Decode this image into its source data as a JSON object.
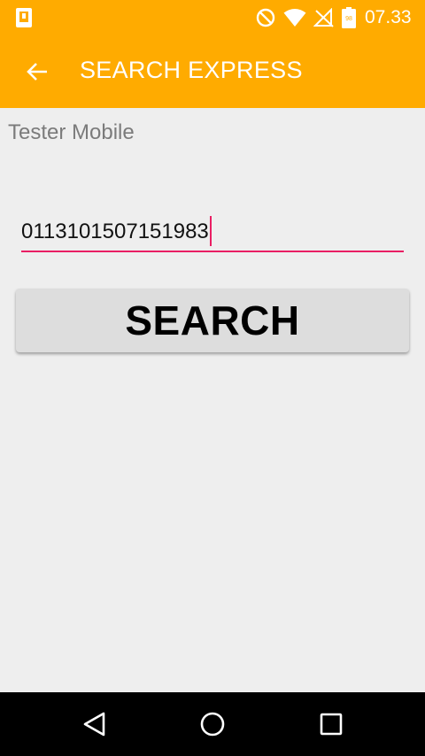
{
  "status_bar": {
    "time": "07.33",
    "icons": [
      "sim-card-icon",
      "do-not-disturb-icon",
      "wifi-icon",
      "no-signal-icon",
      "battery-icon"
    ],
    "battery_level": "98"
  },
  "app_bar": {
    "title": "SEARCH EXPRESS",
    "back_icon": "arrow-back-icon"
  },
  "main": {
    "subtitle": "Tester Mobile",
    "tracking_input": {
      "value": "0113101507151983",
      "placeholder": ""
    },
    "search_button_label": "SEARCH"
  },
  "nav_bar": {
    "icons": [
      "back-triangle-icon",
      "home-circle-icon",
      "recents-square-icon"
    ]
  },
  "colors": {
    "accent": "#ffab00",
    "cursor": "#e91e63",
    "background": "#eeeeee",
    "button": "#dddddd"
  }
}
